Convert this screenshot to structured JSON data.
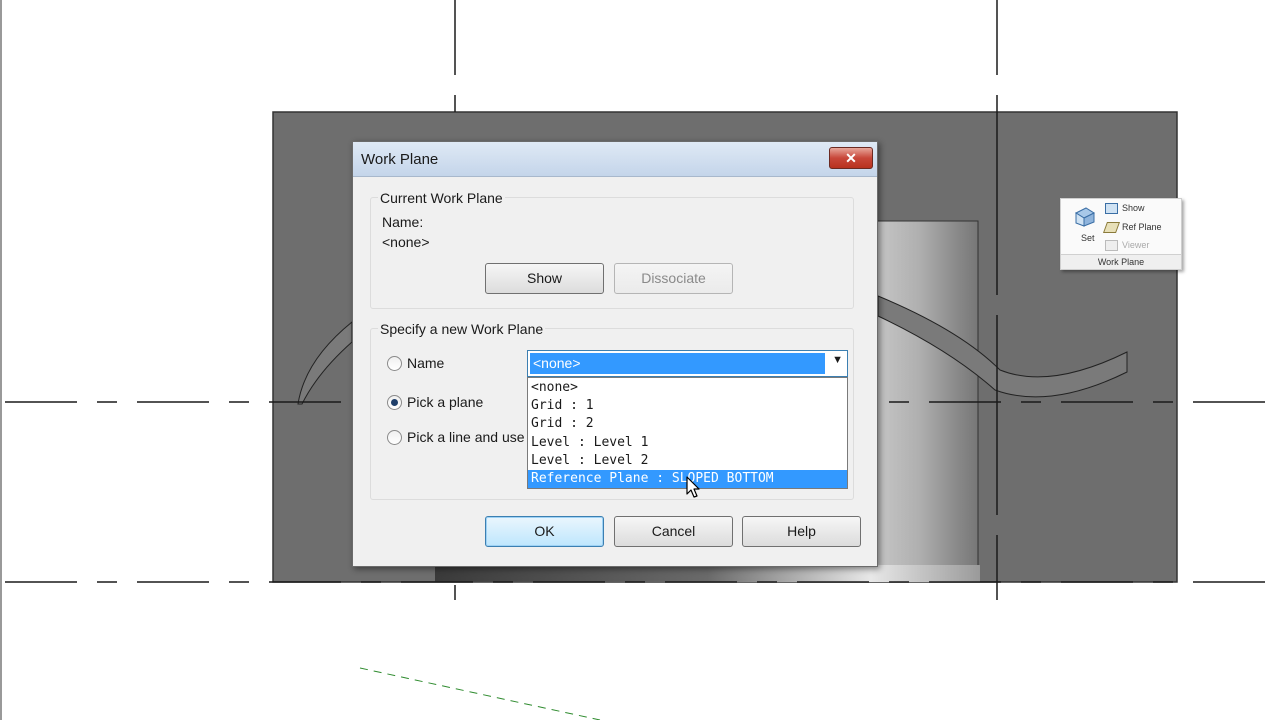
{
  "dialog": {
    "title": "Work Plane",
    "close_glyph": "✕",
    "current": {
      "legend": "Current Work Plane",
      "name_label": "Name:",
      "name_value": "<none>",
      "show_label": "Show",
      "dissociate_label": "Dissociate"
    },
    "specify": {
      "legend": "Specify a new Work Plane",
      "name_option": "Name",
      "pick_plane_option": "Pick a plane",
      "pick_line_option": "Pick a line and use",
      "selected_radio": "pick_plane",
      "combo_value": "<none>",
      "combo_arrow": "▼",
      "dropdown_items": [
        "<none>",
        "Grid : 1",
        "Grid : 2",
        "Level : Level 1",
        "Level : Level 2",
        "Reference Plane : SLOPED BOTTOM"
      ],
      "highlighted_index": 5
    },
    "ok_label": "OK",
    "cancel_label": "Cancel",
    "help_label": "Help"
  },
  "ribbon_panel": {
    "set_label": "Set",
    "show_label": "Show",
    "ref_plane_label": "Ref  Plane",
    "viewer_label": "Viewer",
    "panel_title": "Work Plane"
  },
  "colors": {
    "wall_fill": "#6e6e6e",
    "highlight": "#3399ff",
    "title_bar": "#c4d5ea",
    "close_button": "#c8473a"
  }
}
